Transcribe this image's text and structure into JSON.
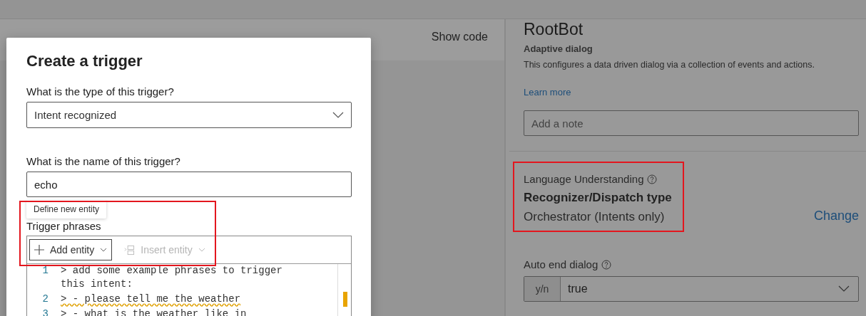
{
  "canvas": {
    "show_code": "Show code"
  },
  "dialog": {
    "title": "Create a trigger",
    "type_field": {
      "label": "What is the type of this trigger?",
      "value": "Intent recognized"
    },
    "name_field": {
      "label": "What is the name of this trigger?",
      "value": "echo"
    },
    "phrases": {
      "label": "Trigger phrases",
      "tooltip": "Define new entity",
      "tools": [
        {
          "label": "Add entity",
          "disabled": false,
          "kind": "add"
        },
        {
          "label": "Insert entity",
          "disabled": true,
          "kind": "insert"
        }
      ],
      "lines": [
        {
          "number": "1",
          "text": "> add some example phrases to trigger this intent:",
          "squiggle": false
        },
        {
          "number": "2",
          "text": "> - please tell me the weather",
          "squiggle": true
        },
        {
          "number": "3",
          "text": "> - what is the weather like in"
        }
      ]
    }
  },
  "properties": {
    "title": "RootBot",
    "subtitle": "Adaptive dialog",
    "description": "This configures a data driven dialog via a collection of events and actions.",
    "link": "Learn more",
    "note": {
      "placeholder": "Add a note"
    },
    "language": {
      "label": "Language Understanding",
      "heading": "Recognizer/Dispatch type",
      "value": "Orchestrator (Intents only)",
      "action": "Change"
    },
    "auto_end": {
      "label": "Auto end dialog",
      "prefix": "y/n",
      "value": "true"
    }
  }
}
